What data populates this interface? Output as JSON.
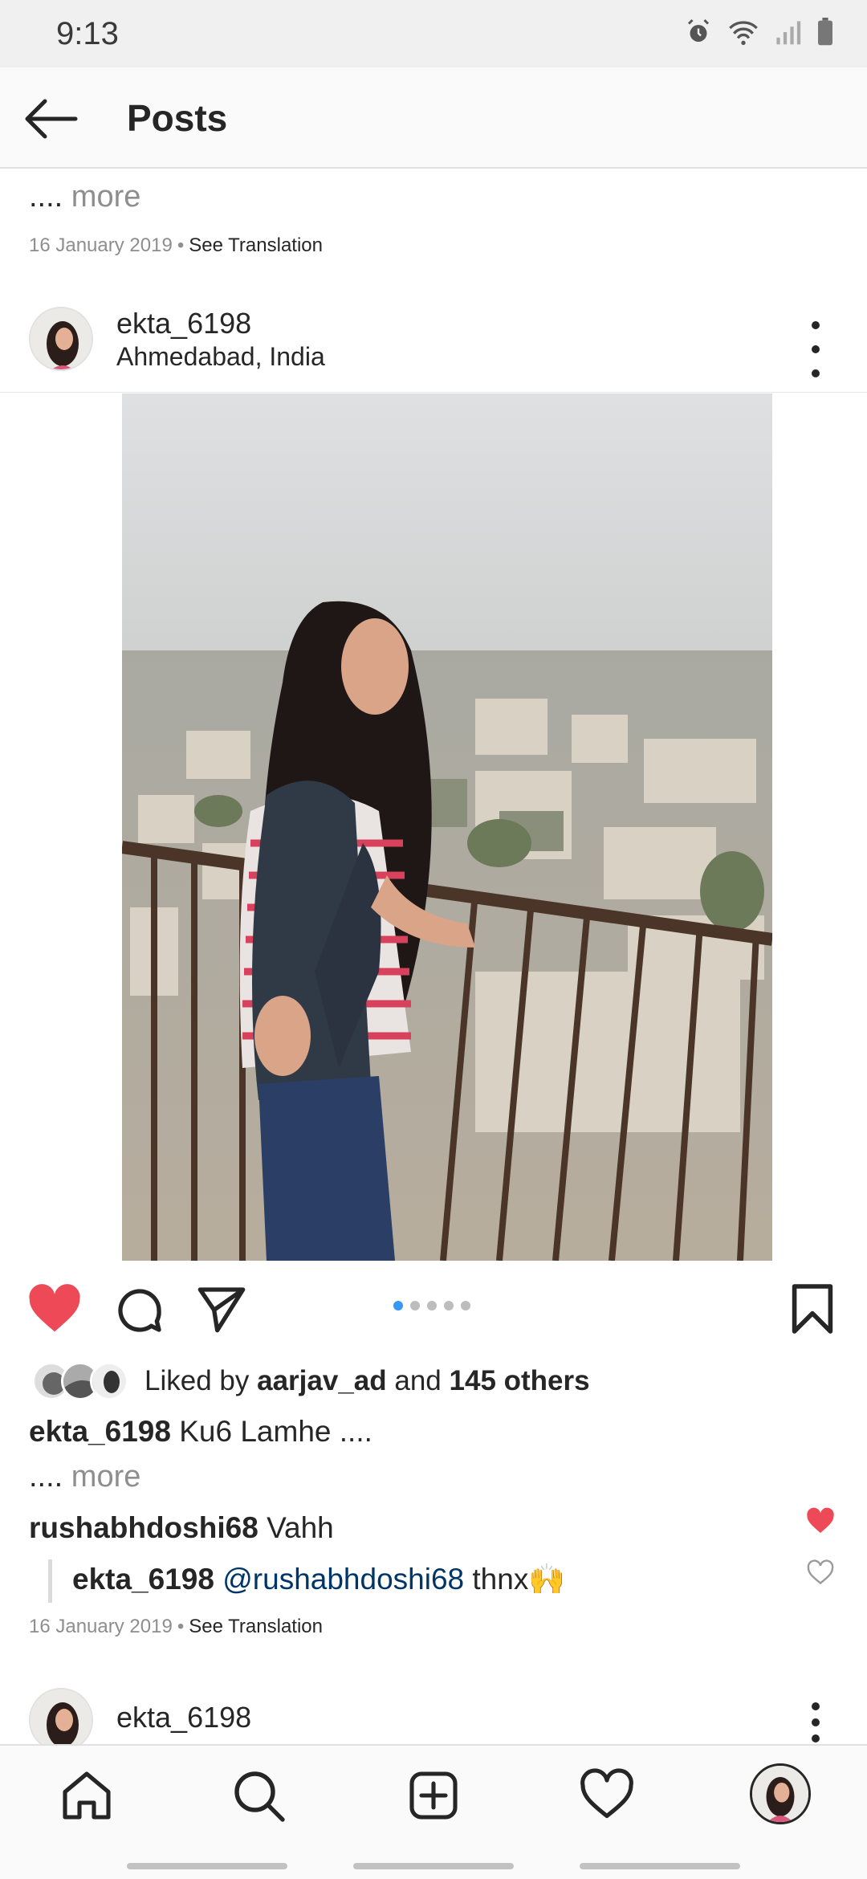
{
  "status_bar": {
    "time": "9:13",
    "icons": [
      "alarm-icon",
      "wifi-icon",
      "signal-icon",
      "battery-icon"
    ]
  },
  "header": {
    "title": "Posts",
    "back_icon": "back-arrow-icon"
  },
  "previous_post": {
    "more_dots": "....",
    "more_label": "more",
    "date": "16 January 2019",
    "separator": "•",
    "translation_label": "See Translation"
  },
  "post": {
    "username": "ekta_6198",
    "location": "Ahmedabad, India",
    "carousel_pages": 5,
    "carousel_active_index": 0,
    "liked": true,
    "likes": {
      "prefix": "Liked by",
      "first_liker": "aarjav_ad",
      "connector": "and",
      "others": "145 others"
    },
    "caption": {
      "username": "ekta_6198",
      "text": "Ku6 Lamhe ....",
      "more_dots": "....",
      "more_label": "more"
    },
    "comments": [
      {
        "username": "rushabhdoshi68",
        "text": "Vahh",
        "liked": true
      },
      {
        "username": "ekta_6198",
        "mention": "@rushabhdoshi68",
        "text": "thnx🙌",
        "liked": false,
        "is_reply": true
      }
    ],
    "date": "16 January 2019",
    "separator": "•",
    "translation_label": "See Translation"
  },
  "next_post": {
    "username": "ekta_6198"
  },
  "bottom_nav": {
    "items": [
      "home-icon",
      "search-icon",
      "new-post-icon",
      "activity-heart-icon",
      "profile-avatar"
    ]
  },
  "colors": {
    "like_red": "#ed4956",
    "mention_blue": "#003569",
    "carousel_active": "#3897f0",
    "text_primary": "#262626",
    "text_secondary": "#8e8e8e"
  }
}
